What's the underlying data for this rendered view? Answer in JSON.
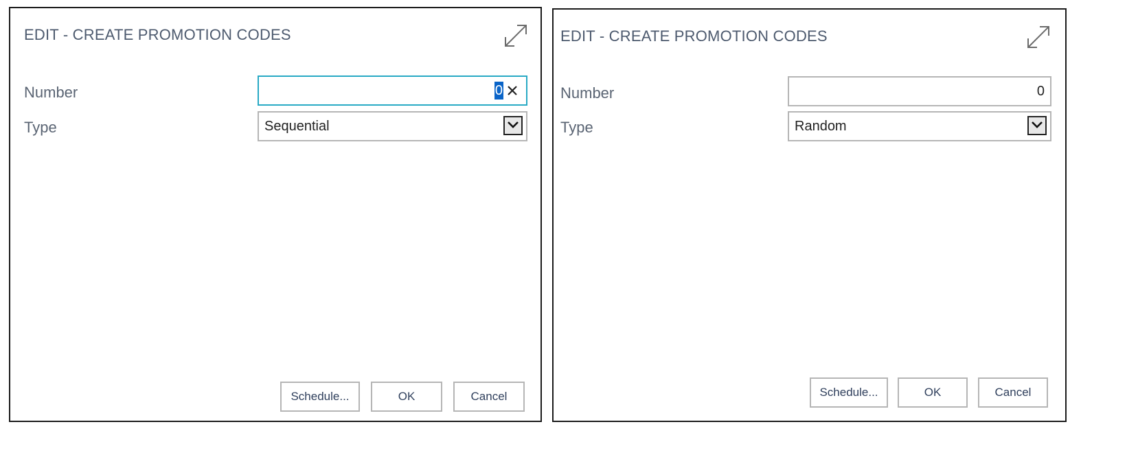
{
  "dialogs": [
    {
      "title": "EDIT - CREATE PROMOTION CODES",
      "number_label": "Number",
      "number_value": "0",
      "type_label": "Type",
      "type_value": "Sequential",
      "buttons": {
        "schedule": "Schedule...",
        "ok": "OK",
        "cancel": "Cancel"
      }
    },
    {
      "title": "EDIT - CREATE PROMOTION CODES",
      "number_label": "Number",
      "number_value": "0",
      "type_label": "Type",
      "type_value": "Random",
      "buttons": {
        "schedule": "Schedule...",
        "ok": "OK",
        "cancel": "Cancel"
      }
    }
  ],
  "icons": {
    "expand": "expand-icon",
    "clear": "close-icon",
    "dropdown": "chevron-down-icon"
  },
  "colors": {
    "focus_border": "#27a9c4",
    "selection": "#0a64c8",
    "title_text": "#4d5a6e"
  }
}
